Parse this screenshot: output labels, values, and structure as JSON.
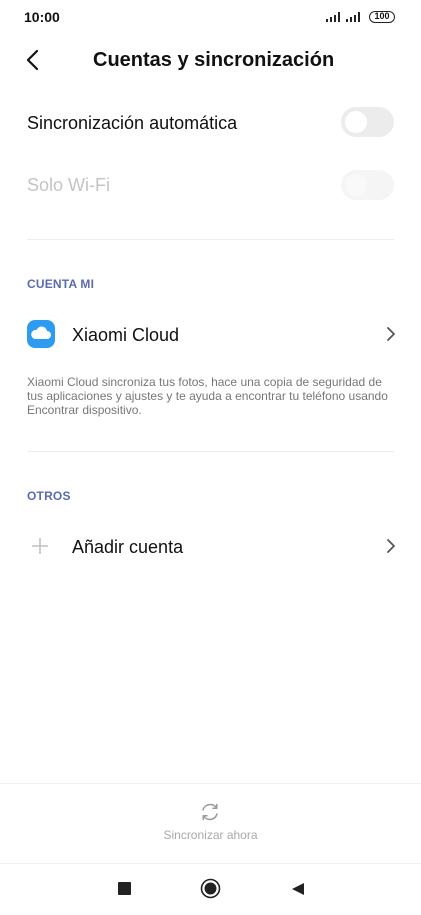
{
  "status": {
    "time": "10:00",
    "battery": "100"
  },
  "header": {
    "title": "Cuentas y sincronización"
  },
  "settings": {
    "auto_sync": {
      "label": "Sincronización automática",
      "enabled": false
    },
    "wifi_only": {
      "label": "Solo Wi-Fi",
      "enabled": false,
      "disabled": true
    }
  },
  "sections": {
    "mi_account": {
      "title": "CUENTA MI"
    },
    "others": {
      "title": "OTROS"
    }
  },
  "mi_cloud": {
    "label": "Xiaomi Cloud",
    "icon": "cloud-icon",
    "icon_color": "#2d9bf0",
    "description": "Xiaomi Cloud sincroniza tus fotos, hace una copia de seguridad de tus aplicaciones y ajustes y te ayuda a encontrar tu teléfono usando Encontrar dispositivo."
  },
  "add_account": {
    "label": "Añadir cuenta",
    "icon": "plus-icon"
  },
  "sync_now": {
    "label": "Sincronizar ahora",
    "icon": "sync-icon"
  },
  "navbar": {
    "icons": [
      "square-icon",
      "circle-home-icon",
      "back-triangle-icon"
    ]
  },
  "colors": {
    "accent_section": "#5b6bb0",
    "toggle_off": "#ececec"
  }
}
